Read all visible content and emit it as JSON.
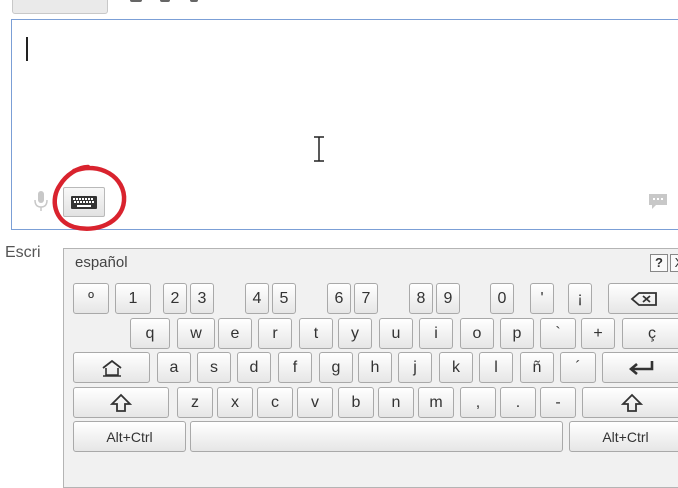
{
  "textarea": {
    "value": ""
  },
  "helper_text": "Escri",
  "virtual_keyboard": {
    "language": "español",
    "help_label": "?",
    "close_label": "X",
    "rows": [
      [
        "º",
        "1",
        "2",
        "3",
        "4",
        "5",
        "6",
        "7",
        "8",
        "9",
        "0",
        "'",
        "¡",
        "backspace-icon"
      ],
      [
        "q",
        "w",
        "e",
        "r",
        "t",
        "y",
        "u",
        "i",
        "o",
        "p",
        "`",
        "+",
        "ç"
      ],
      [
        "home-icon",
        "a",
        "s",
        "d",
        "f",
        "g",
        "h",
        "j",
        "k",
        "l",
        "ñ",
        "´",
        "enter-icon"
      ],
      [
        "shift-icon",
        "z",
        "x",
        "c",
        "v",
        "b",
        "n",
        "m",
        ",",
        ".",
        "-",
        "shift-icon"
      ],
      [
        "Alt+Ctrl",
        "space",
        "Alt+Ctrl"
      ]
    ],
    "alt_ctrl_left": "Alt+Ctrl",
    "alt_ctrl_right": "Alt+Ctrl"
  },
  "highlight_color": "#d9232e",
  "border_color": "#7b9fd6"
}
